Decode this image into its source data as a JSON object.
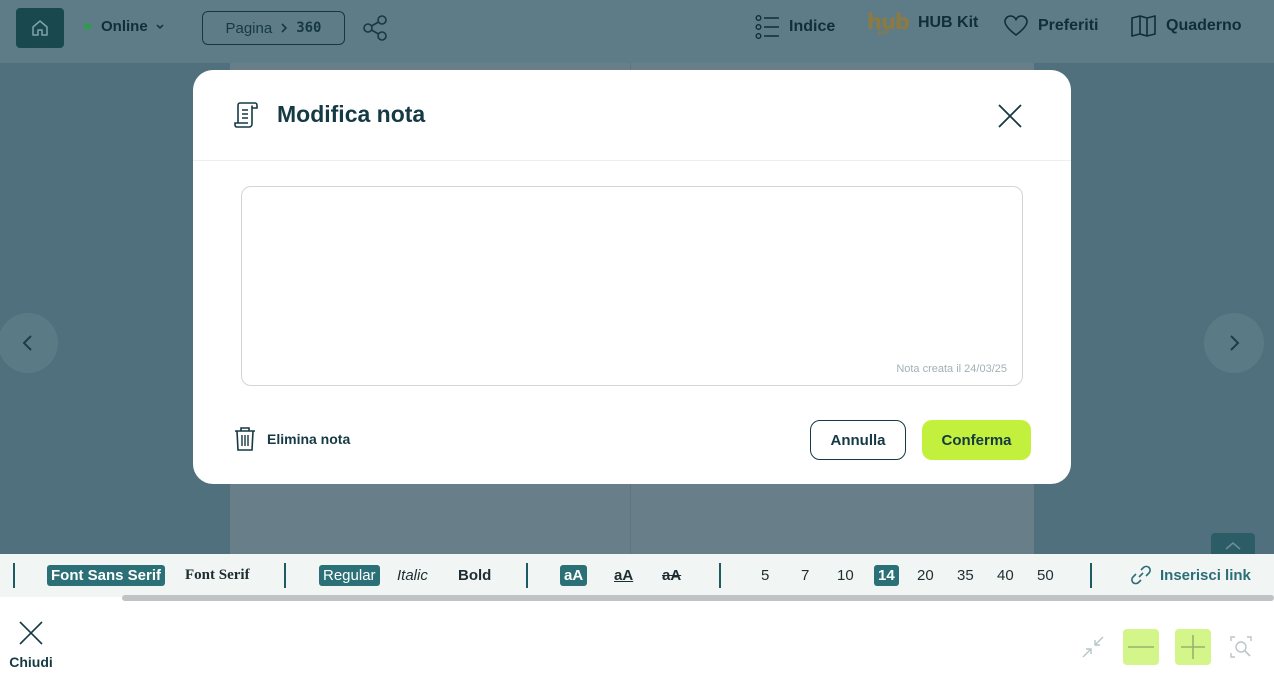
{
  "header": {
    "status_label": "Online",
    "page_prefix": "Pagina",
    "page_number": "360",
    "nav": [
      {
        "label": "Indice",
        "icon": "list-icon"
      },
      {
        "label": "HUB Kit",
        "icon": "hub-kit-logo"
      },
      {
        "label": "Preferiti",
        "icon": "heart-icon"
      },
      {
        "label": "Quaderno",
        "icon": "notebook-icon"
      }
    ],
    "hub_logo_text": "hub",
    "hub_logo_sub": "KIT"
  },
  "modal": {
    "title": "Modifica nota",
    "note_value": "",
    "note_date": "Nota creata il 24/03/25",
    "delete_label": "Elimina nota",
    "cancel_label": "Annulla",
    "confirm_label": "Conferma"
  },
  "toolbar": {
    "font_sans": "Font Sans Serif",
    "font_serif": "Font Serif",
    "regular": "Regular",
    "italic": "Italic",
    "bold": "Bold",
    "case_normal": "aA",
    "case_underline": "aA",
    "case_strike": "aA",
    "sizes": [
      "5",
      "7",
      "10",
      "14",
      "20",
      "35",
      "40",
      "50"
    ],
    "selected_size": "14",
    "link_label": "Inserisci link"
  },
  "bottom": {
    "close_label": "Chiudi"
  },
  "colors": {
    "accent_dark": "#19484f",
    "accent_teal": "#2b7077",
    "confirm_green": "#c2f03c",
    "status_online": "#2f9b4d"
  }
}
